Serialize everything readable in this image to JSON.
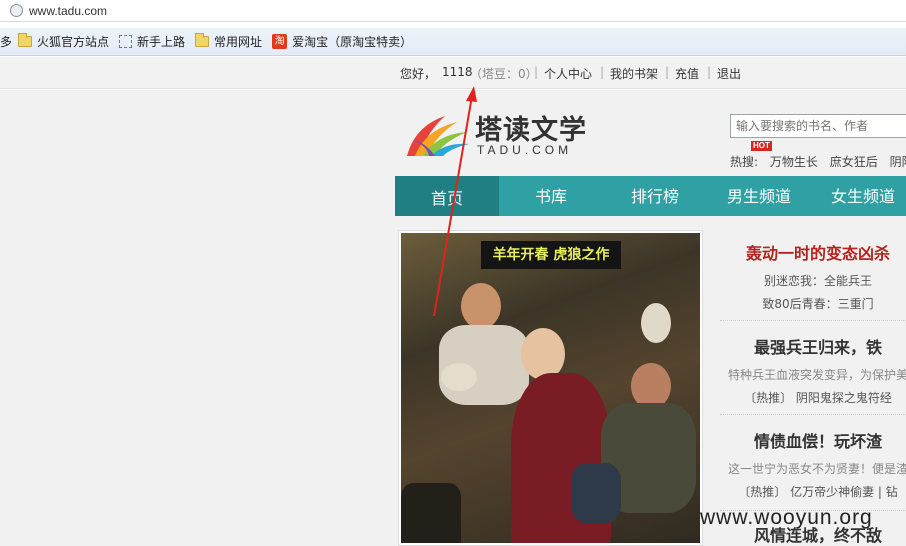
{
  "browser": {
    "url": "www.tadu.com",
    "bookmarks": [
      {
        "label": "多",
        "icon": "none"
      },
      {
        "label": "火狐官方站点",
        "icon": "folder-icon"
      },
      {
        "label": "新手上路",
        "icon": "dashed-box-icon"
      },
      {
        "label": "常用网址",
        "icon": "folder-icon"
      },
      {
        "label": "爱淘宝（原淘宝特卖）",
        "icon": "taobao-icon",
        "icon_text": "淘"
      }
    ]
  },
  "topnav": {
    "greeting": "您好，",
    "user_id": "1118",
    "beans": "（塔豆：0）",
    "separator": "|",
    "links": [
      "个人中心",
      "我的书架",
      "充值",
      "退出"
    ]
  },
  "header": {
    "logo_title": "塔读文学",
    "logo_sub": "TADU.COM",
    "search_placeholder": "输入要搜索的书名、作者",
    "hot_badge": "HOT",
    "hot_label": "热搜:",
    "hot_terms": [
      "万物生长",
      "庶女狂后",
      "阴阳"
    ]
  },
  "mainnav": {
    "tabs": [
      "首页",
      "书库",
      "排行榜",
      "男生频道",
      "女生频道"
    ],
    "active": 0
  },
  "poster": {
    "banner": "羊年开春  虎狼之作"
  },
  "articles": [
    {
      "title": "轰动一时的变态凶杀",
      "title_color": "#b4231f",
      "lines": [
        "别迷恋我：全能兵王",
        "致80后青春：三重门"
      ]
    },
    {
      "title": "最强兵王归来，铁",
      "title_color": "#222222",
      "lines": [
        "特种兵王血液突发变异，为保护美",
        "〔热推〕  阴阳鬼探之鬼符经"
      ]
    },
    {
      "title": "情债血偿！玩坏渣",
      "title_color": "#222222",
      "lines": [
        "这一世宁为恶女不为贤妻！便是渣",
        "〔热推〕  亿万帝少神偷妻  | 钻"
      ]
    },
    {
      "title": "风情连城，终不敌",
      "title_color": "#222222",
      "lines": []
    }
  ],
  "watermark": "www.wooyun.org",
  "colors": {
    "nav_bg": "#2fa0a3",
    "nav_active": "#1f7f82",
    "headline_red": "#b4231f",
    "arrow": "#e0231c"
  }
}
